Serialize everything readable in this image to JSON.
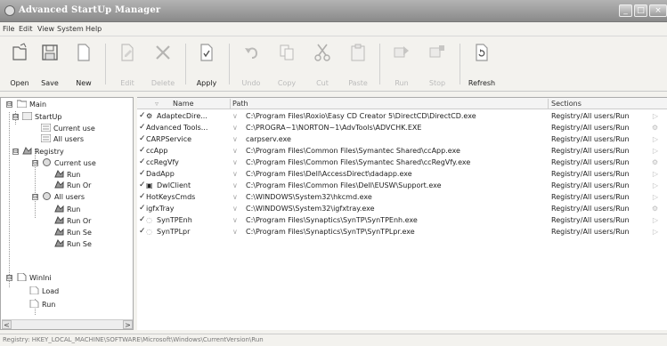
{
  "window": {
    "title": "Advanced StartUp Manager",
    "controls": {
      "minimize": "_",
      "maximize": "□",
      "close": "×"
    }
  },
  "menu": [
    "File",
    "Edit",
    "View",
    "System",
    "Help"
  ],
  "toolbar": [
    {
      "label": "Open",
      "icon": "open-icon",
      "enabled": true
    },
    {
      "label": "Save",
      "icon": "save-icon",
      "enabled": true
    },
    {
      "label": "New",
      "icon": "new-icon",
      "enabled": true
    },
    {
      "label": "Edit",
      "icon": "edit-icon",
      "enabled": false
    },
    {
      "label": "Delete",
      "icon": "delete-icon",
      "enabled": false
    },
    {
      "label": "Apply",
      "icon": "apply-icon",
      "enabled": true
    },
    {
      "label": "Undo",
      "icon": "undo-icon",
      "enabled": false
    },
    {
      "label": "Copy",
      "icon": "copy-icon",
      "enabled": false
    },
    {
      "label": "Cut",
      "icon": "cut-icon",
      "enabled": false
    },
    {
      "label": "Paste",
      "icon": "paste-icon",
      "enabled": false
    },
    {
      "label": "Run",
      "icon": "run-icon",
      "enabled": false
    },
    {
      "label": "Stop",
      "icon": "stop-icon",
      "enabled": false
    },
    {
      "label": "Refresh",
      "icon": "refresh-icon",
      "enabled": true
    }
  ],
  "tree": [
    {
      "label": "Main",
      "expander": "⊟"
    },
    {
      "label": "StartUp",
      "expander": "⊟"
    },
    {
      "label": "Current use"
    },
    {
      "label": "All users"
    },
    {
      "label": "Registry",
      "expander": "⊟"
    },
    {
      "label": "Current use",
      "expander": "⊟"
    },
    {
      "label": "Run"
    },
    {
      "label": "Run Or"
    },
    {
      "label": "All users",
      "expander": "⊟"
    },
    {
      "label": "Run"
    },
    {
      "label": "Run Or"
    },
    {
      "label": "Run Se"
    },
    {
      "label": "Run Se"
    },
    {
      "label": "WinIni",
      "expander": "⊟"
    },
    {
      "label": "Load"
    },
    {
      "label": "Run"
    }
  ],
  "scroll": {
    "left": "<",
    "right": ">"
  },
  "list": {
    "columns": [
      "Name",
      "Path",
      "Sections"
    ],
    "rows": [
      {
        "check": "✓",
        "name": "AdaptecDire...",
        "path": "C:\\Program Files\\Roxio\\Easy CD Creator 5\\DirectCD\\DirectCD.exe",
        "section": "Registry/All users/Run"
      },
      {
        "check": "✓",
        "name": "Advanced Tools...",
        "path": "C:\\PROGRA~1\\NORTON~1\\AdvTools\\ADVCHK.EXE",
        "section": "Registry/All users/Run"
      },
      {
        "check": "✓",
        "name": "CARPService",
        "path": "carpserv.exe",
        "section": "Registry/All users/Run"
      },
      {
        "check": "✓",
        "name": "ccApp",
        "path": "C:\\Program Files\\Common Files\\Symantec Shared\\ccApp.exe",
        "section": "Registry/All users/Run"
      },
      {
        "check": "✓",
        "name": "ccRegVfy",
        "path": "C:\\Program Files\\Common Files\\Symantec Shared\\ccRegVfy.exe",
        "section": "Registry/All users/Run"
      },
      {
        "check": "✓",
        "name": "DadApp",
        "path": "C:\\Program Files\\Dell\\AccessDirect\\dadapp.exe",
        "section": "Registry/All users/Run"
      },
      {
        "check": "✓",
        "name": "DwlClient",
        "path": "C:\\Program Files\\Common Files\\Dell\\EUSW\\Support.exe",
        "section": "Registry/All users/Run"
      },
      {
        "check": "✓",
        "name": "HotKeysCmds",
        "path": "C:\\WINDOWS\\System32\\hkcmd.exe",
        "section": "Registry/All users/Run"
      },
      {
        "check": "✓",
        "name": "igfxTray",
        "path": "C:\\WINDOWS\\System32\\igfxtray.exe",
        "section": "Registry/All users/Run"
      },
      {
        "check": "✓",
        "name": "SynTPEnh",
        "path": "C:\\Program Files\\Synaptics\\SynTP\\SynTPEnh.exe",
        "section": "Registry/All users/Run"
      },
      {
        "check": "✓",
        "name": "SynTPLpr",
        "path": "C:\\Program Files\\Synaptics\\SynTP\\SynTPLpr.exe",
        "section": "Registry/All users/Run"
      }
    ]
  },
  "status": "Registry: HKEY_LOCAL_MACHINE\\SOFTWARE\\Microsoft\\Windows\\CurrentVersion\\Run"
}
